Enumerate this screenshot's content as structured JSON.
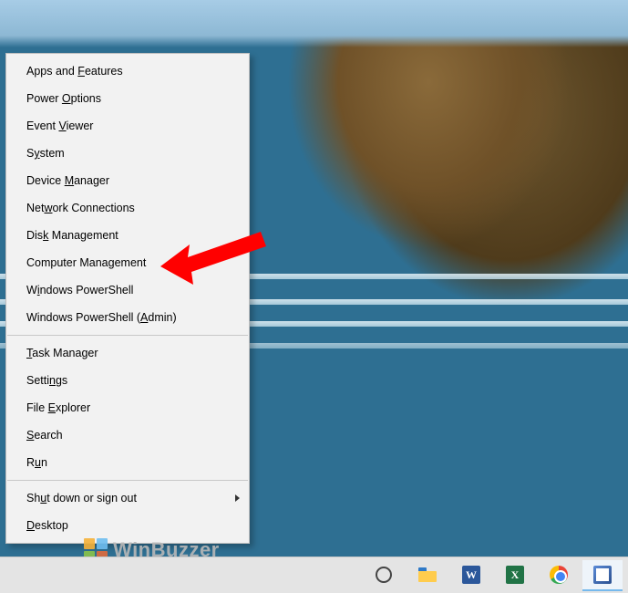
{
  "menu": {
    "groups": [
      [
        {
          "id": "apps-features",
          "pre": "Apps and ",
          "u": "F",
          "post": "eatures"
        },
        {
          "id": "power-options",
          "pre": "Power ",
          "u": "O",
          "post": "ptions"
        },
        {
          "id": "event-viewer",
          "pre": "Event ",
          "u": "V",
          "post": "iewer"
        },
        {
          "id": "system",
          "pre": "S",
          "u": "y",
          "post": "stem"
        },
        {
          "id": "device-manager",
          "pre": "Device ",
          "u": "M",
          "post": "anager"
        },
        {
          "id": "network-connections",
          "pre": "Net",
          "u": "w",
          "post": "ork Connections"
        },
        {
          "id": "disk-management",
          "pre": "Dis",
          "u": "k",
          "post": " Management"
        },
        {
          "id": "computer-management",
          "pre": "Computer Mana",
          "u": "g",
          "post": "ement"
        },
        {
          "id": "powershell",
          "pre": "W",
          "u": "i",
          "post": "ndows PowerShell"
        },
        {
          "id": "powershell-admin",
          "pre": "Windows PowerShell (",
          "u": "A",
          "post": "dmin)"
        }
      ],
      [
        {
          "id": "task-manager",
          "pre": "",
          "u": "T",
          "post": "ask Manager"
        },
        {
          "id": "settings",
          "pre": "Setti",
          "u": "n",
          "post": "gs"
        },
        {
          "id": "file-explorer",
          "pre": "File ",
          "u": "E",
          "post": "xplorer"
        },
        {
          "id": "search",
          "pre": "",
          "u": "S",
          "post": "earch"
        },
        {
          "id": "run",
          "pre": "R",
          "u": "u",
          "post": "n"
        }
      ],
      [
        {
          "id": "shutdown",
          "pre": "Sh",
          "u": "u",
          "post": "t down or sign out",
          "submenu": true
        },
        {
          "id": "desktop",
          "pre": "",
          "u": "D",
          "post": "esktop"
        }
      ]
    ]
  },
  "annotation": {
    "target_id": "computer-management"
  },
  "taskbar": {
    "items": [
      {
        "id": "cortana",
        "name": "cortana-icon",
        "label": "Cortana / Search",
        "running": false
      },
      {
        "id": "explorer",
        "name": "file-explorer-icon",
        "label": "File Explorer",
        "running": false
      },
      {
        "id": "word",
        "name": "word-icon",
        "label": "Microsoft Word",
        "glyph": "W",
        "running": false
      },
      {
        "id": "excel",
        "name": "excel-icon",
        "label": "Microsoft Excel",
        "glyph": "X",
        "running": false
      },
      {
        "id": "chrome",
        "name": "chrome-icon",
        "label": "Google Chrome",
        "running": false
      },
      {
        "id": "paint",
        "name": "paint-icon",
        "label": "Paint",
        "running": true
      }
    ]
  },
  "watermark": {
    "text": "WinBuzzer"
  }
}
